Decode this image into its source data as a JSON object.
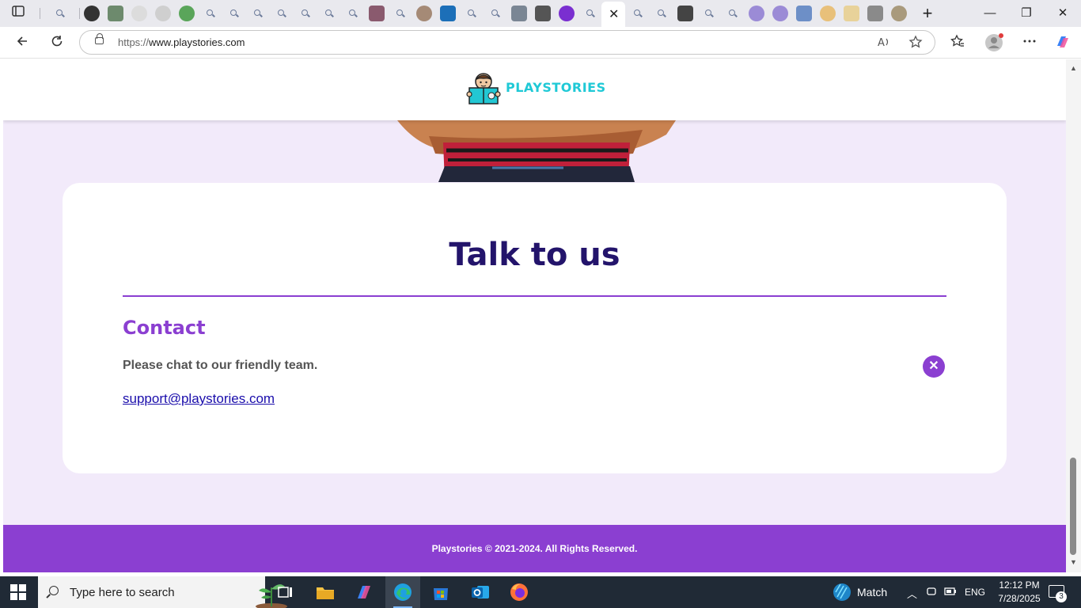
{
  "browser": {
    "url_scheme": "https://",
    "url_host": "www.playstories.com",
    "active_tab_close": "✕",
    "new_tab": "+",
    "minimize": "—",
    "restore": "❐",
    "close": "✕"
  },
  "site": {
    "brand": "PLAYSTORIES",
    "brand_color": "#1fc9d6",
    "accent_color": "#8b3fd1",
    "title_color": "#23146b"
  },
  "contact_card": {
    "title": "Talk to us",
    "heading": "Contact",
    "text": "Please chat to our friendly team.",
    "email": "support@playstories.com",
    "close_glyph": "✕"
  },
  "footer": {
    "text": "Playstories © 2021-2024. All Rights Reserved."
  },
  "taskbar": {
    "search_placeholder": "Type here to search",
    "weather": "Match",
    "language": "ENG",
    "time": "12:12 PM",
    "date": "7/28/2025",
    "notification_count": "3"
  }
}
